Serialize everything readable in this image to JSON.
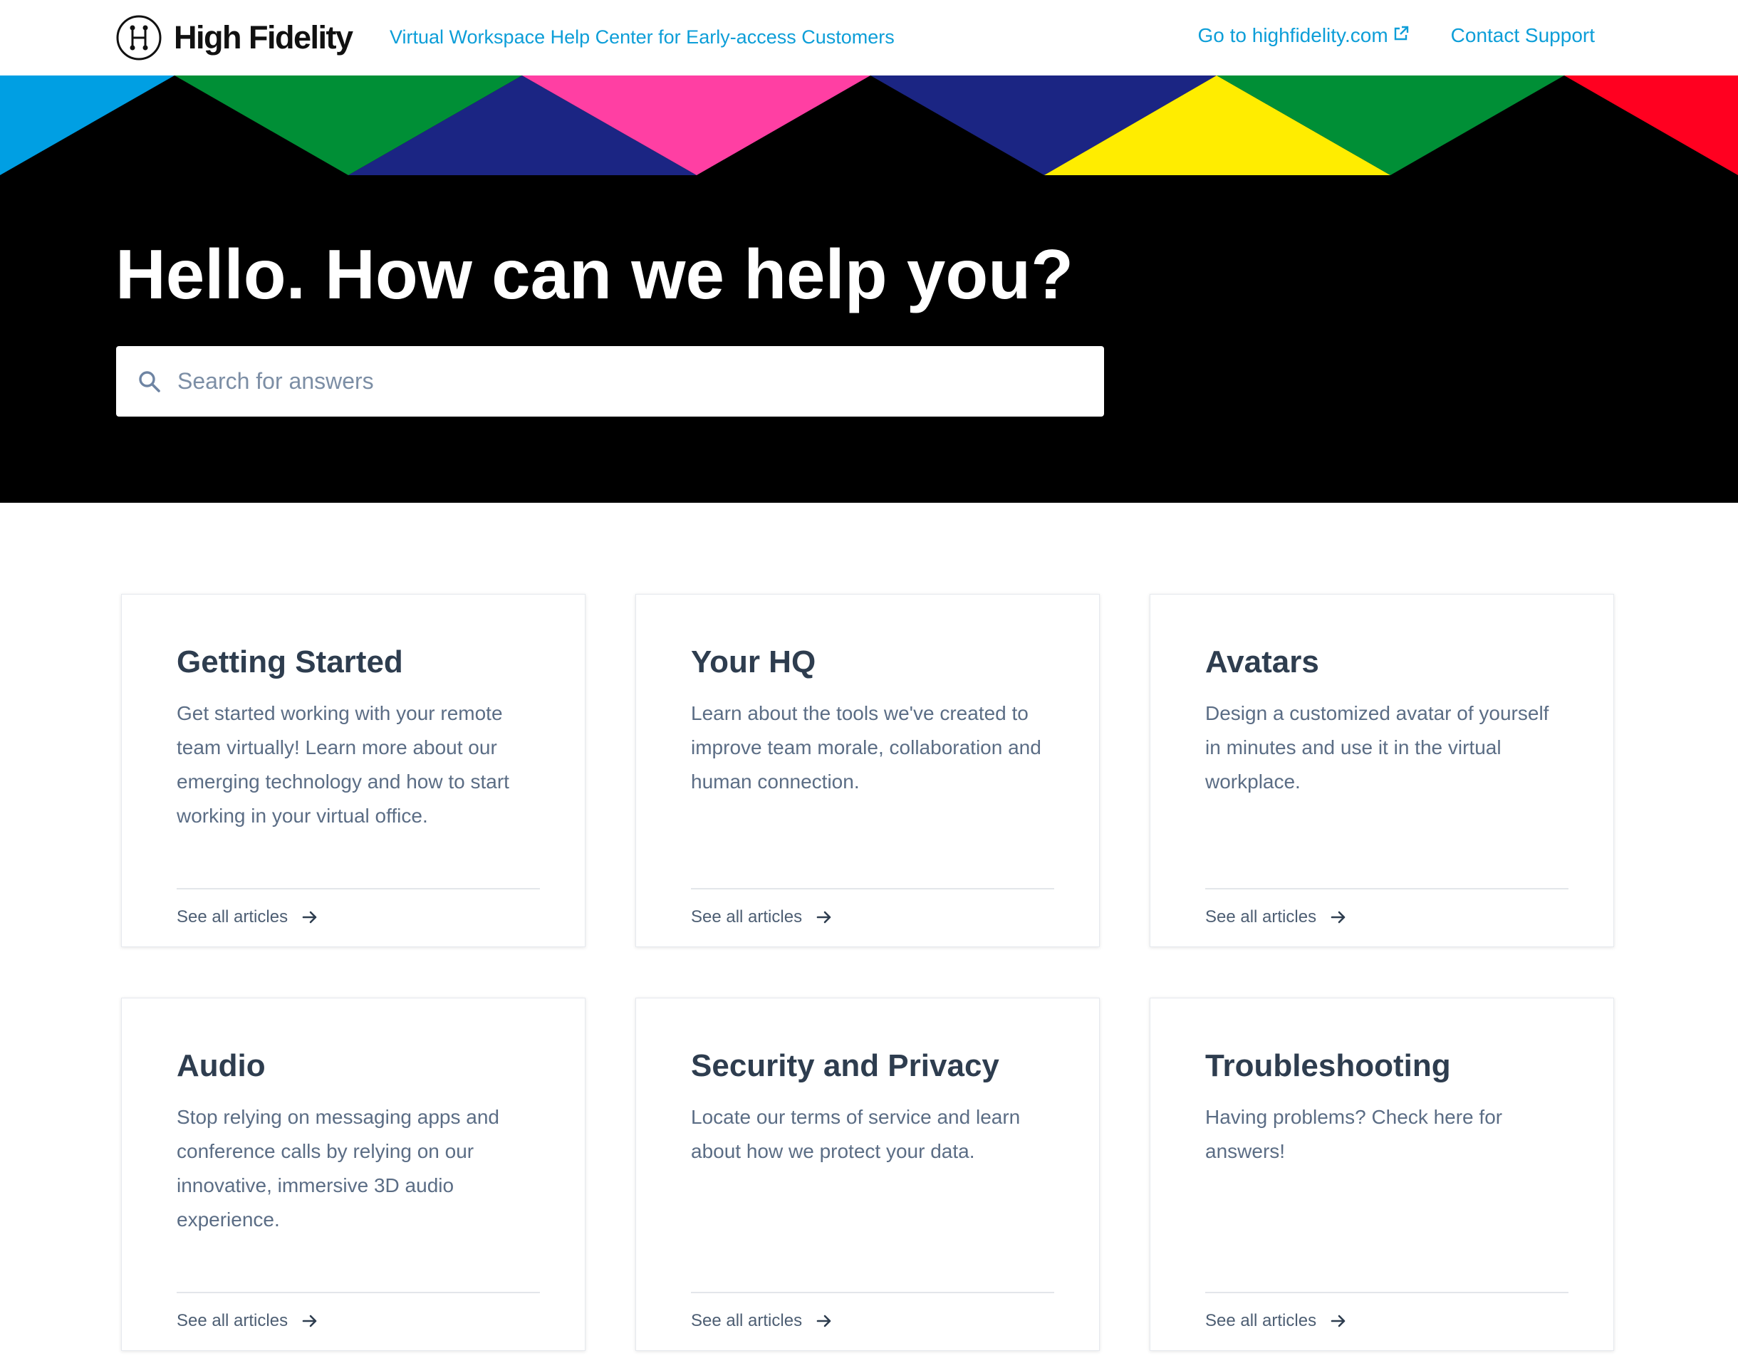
{
  "header": {
    "logo_text": "High Fidelity",
    "tagline": "Virtual Workspace Help Center for Early-access Customers",
    "nav": {
      "website_label": "Go to highfidelity.com",
      "support_label": "Contact Support"
    }
  },
  "hero": {
    "title": "Hello. How can we help you?",
    "search": {
      "placeholder": "Search for answers",
      "value": ""
    },
    "pattern_colors": [
      "#009fe3",
      "#008f36",
      "#1b2583",
      "#ff3fa3",
      "#1b2583",
      "#ffed00",
      "#008f36",
      "#ff0020"
    ]
  },
  "categories": [
    {
      "title": "Getting Started",
      "description": "Get started working with your remote team virtually! Learn more about our emerging technology and how to start working in your virtual office.",
      "link_label": "See all articles"
    },
    {
      "title": "Your HQ",
      "description": "Learn about the tools we've created to improve team morale, collaboration and human connection.",
      "link_label": "See all articles"
    },
    {
      "title": "Avatars",
      "description": "Design a customized avatar of yourself in minutes and use it in the virtual workplace.",
      "link_label": "See all articles"
    },
    {
      "title": "Audio",
      "description": "Stop relying on messaging apps and conference calls by relying on our innovative, immersive 3D audio experience.",
      "link_label": "See all articles"
    },
    {
      "title": "Security and Privacy",
      "description": "Locate our terms of service and learn about how we protect your data.",
      "link_label": "See all articles"
    },
    {
      "title": "Troubleshooting",
      "description": "Having problems? Check here for answers!",
      "link_label": "See all articles"
    }
  ],
  "colors": {
    "link_blue": "#0d9ed8",
    "heading_navy": "#2e3d4f",
    "body_slate": "#5b6d85",
    "hero_background": "#000000"
  },
  "icons": {
    "logo": "logo-h-mark-icon",
    "external": "external-link-icon",
    "search": "search-icon",
    "arrow": "arrow-right-icon"
  }
}
